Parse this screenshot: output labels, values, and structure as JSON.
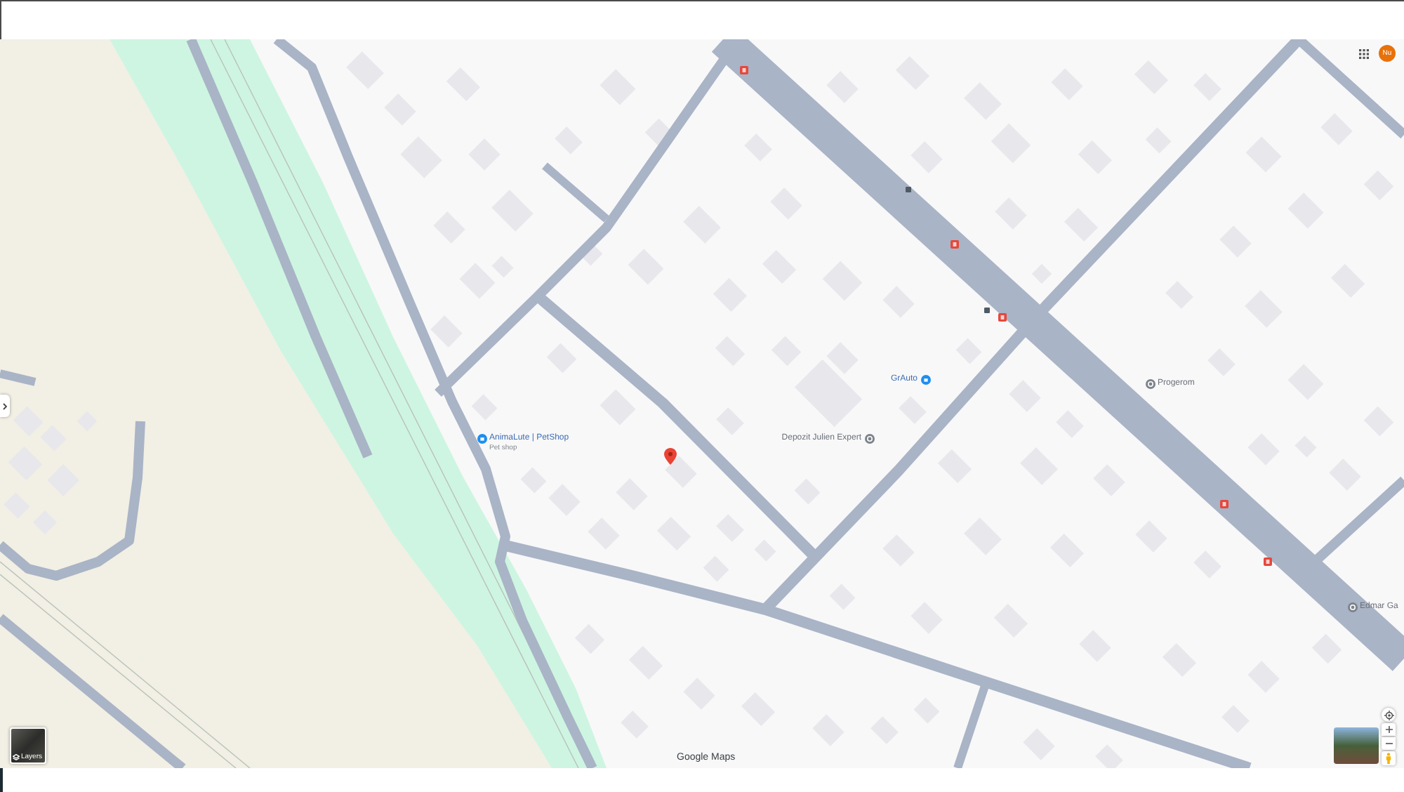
{
  "account": {
    "initials": "Nu"
  },
  "places": [
    {
      "name": "AnimaLute | PetShop",
      "category": "Pet shop",
      "kind": "shop"
    },
    {
      "name": "GrAuto",
      "kind": "shop"
    },
    {
      "name": "Depozit Julien Expert",
      "kind": "place"
    },
    {
      "name": "Progerom",
      "kind": "place"
    },
    {
      "name": "Edmar Ga",
      "kind": "place"
    }
  ],
  "layers_button": {
    "label": "Layers"
  },
  "attribution": "Google Maps"
}
